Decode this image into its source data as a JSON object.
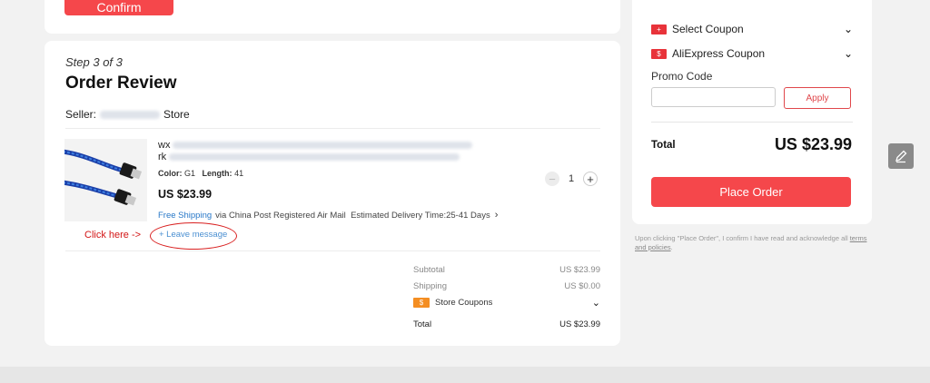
{
  "top_card": {
    "confirm_label": "Confirm"
  },
  "order": {
    "step": "Step 3 of 3",
    "title": "Order Review",
    "seller_prefix": "Seller:",
    "seller_suffix": "Store",
    "item": {
      "title_line1_prefix": "wx",
      "title_line2_prefix": "rk",
      "color_label": "Color:",
      "color_value": "G1",
      "length_label": "Length:",
      "length_value": "41",
      "price": "US $23.99",
      "free_shipping": "Free Shipping",
      "shipping_via": "via China Post Registered Air Mail",
      "delivery": "Estimated Delivery Time:25-41 Days",
      "quantity": "1",
      "qty_minus": "−",
      "qty_plus": "+"
    },
    "annotation": "Click here ->",
    "leave_message": "+ Leave message",
    "summary": {
      "subtotal_label": "Subtotal",
      "subtotal_value": "US $23.99",
      "shipping_label": "Shipping",
      "shipping_value": "US $0.00",
      "coupon_badge": "$",
      "store_coupons": "Store Coupons",
      "total_label": "Total",
      "total_value": "US $23.99"
    }
  },
  "right_panel": {
    "select_coupon": "Select Coupon",
    "select_coupon_badge": "+",
    "aliexpress_coupon": "AliExpress Coupon",
    "aliexpress_coupon_badge": "$",
    "promo_label": "Promo Code",
    "promo_placeholder": "",
    "apply": "Apply",
    "total_label": "Total",
    "total_value": "US $23.99",
    "place_order": "Place Order",
    "disclaimer": "Upon clicking \"Place Order\", I confirm I have read and acknowledge all",
    "terms_link": "terms and policies",
    "disclaimer_end": "."
  },
  "colors": {
    "accent": "#f5474b",
    "link": "#2878c8",
    "annotation": "#d31515"
  },
  "icons": {
    "edit_float": "pencil-icon",
    "chevron": "chevron-down-icon"
  }
}
